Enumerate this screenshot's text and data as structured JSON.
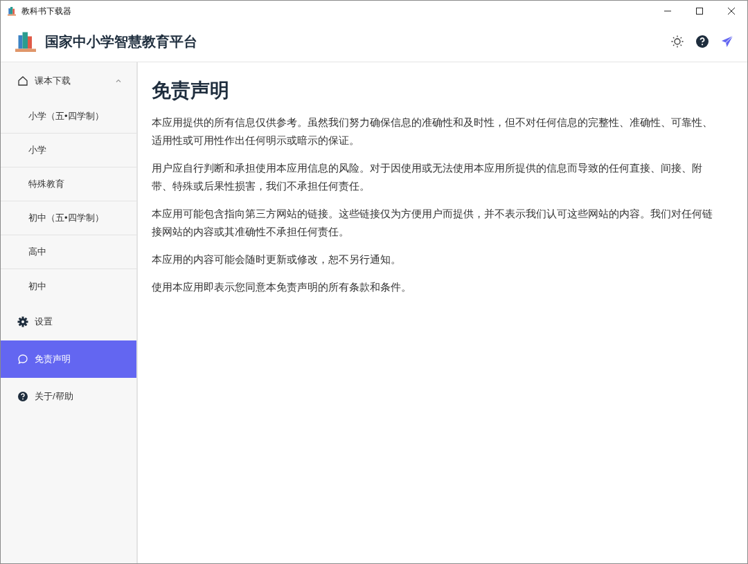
{
  "window": {
    "title": "教科书下载器"
  },
  "header": {
    "title": "国家中小学智慧教育平台"
  },
  "nav": [
    {
      "label": "课本下载",
      "expanded": true,
      "selected": false,
      "children": [
        {
          "label": "小学（五•四学制）",
          "selected": false
        },
        {
          "label": "小学",
          "selected": false
        },
        {
          "label": "特殊教育",
          "selected": false
        },
        {
          "label": "初中（五•四学制）",
          "selected": false
        },
        {
          "label": "高中",
          "selected": false
        },
        {
          "label": "初中",
          "selected": false
        }
      ]
    },
    {
      "label": "设置",
      "selected": false
    },
    {
      "label": "免责声明",
      "selected": true
    },
    {
      "label": "关于/帮助",
      "selected": false
    }
  ],
  "content": {
    "heading": "免责声明",
    "paragraphs": [
      "本应用提供的所有信息仅供参考。虽然我们努力确保信息的准确性和及时性，但不对任何信息的完整性、准确性、可靠性、适用性或可用性作出任何明示或暗示的保证。",
      "用户应自行判断和承担使用本应用信息的风险。对于因使用或无法使用本应用所提供的信息而导致的任何直接、间接、附带、特殊或后果性损害，我们不承担任何责任。",
      "本应用可能包含指向第三方网站的链接。这些链接仅为方便用户而提供，并不表示我们认可这些网站的内容。我们对任何链接网站的内容或其准确性不承担任何责任。",
      "本应用的内容可能会随时更新或修改，恕不另行通知。",
      "使用本应用即表示您同意本免责声明的所有条款和条件。"
    ]
  }
}
